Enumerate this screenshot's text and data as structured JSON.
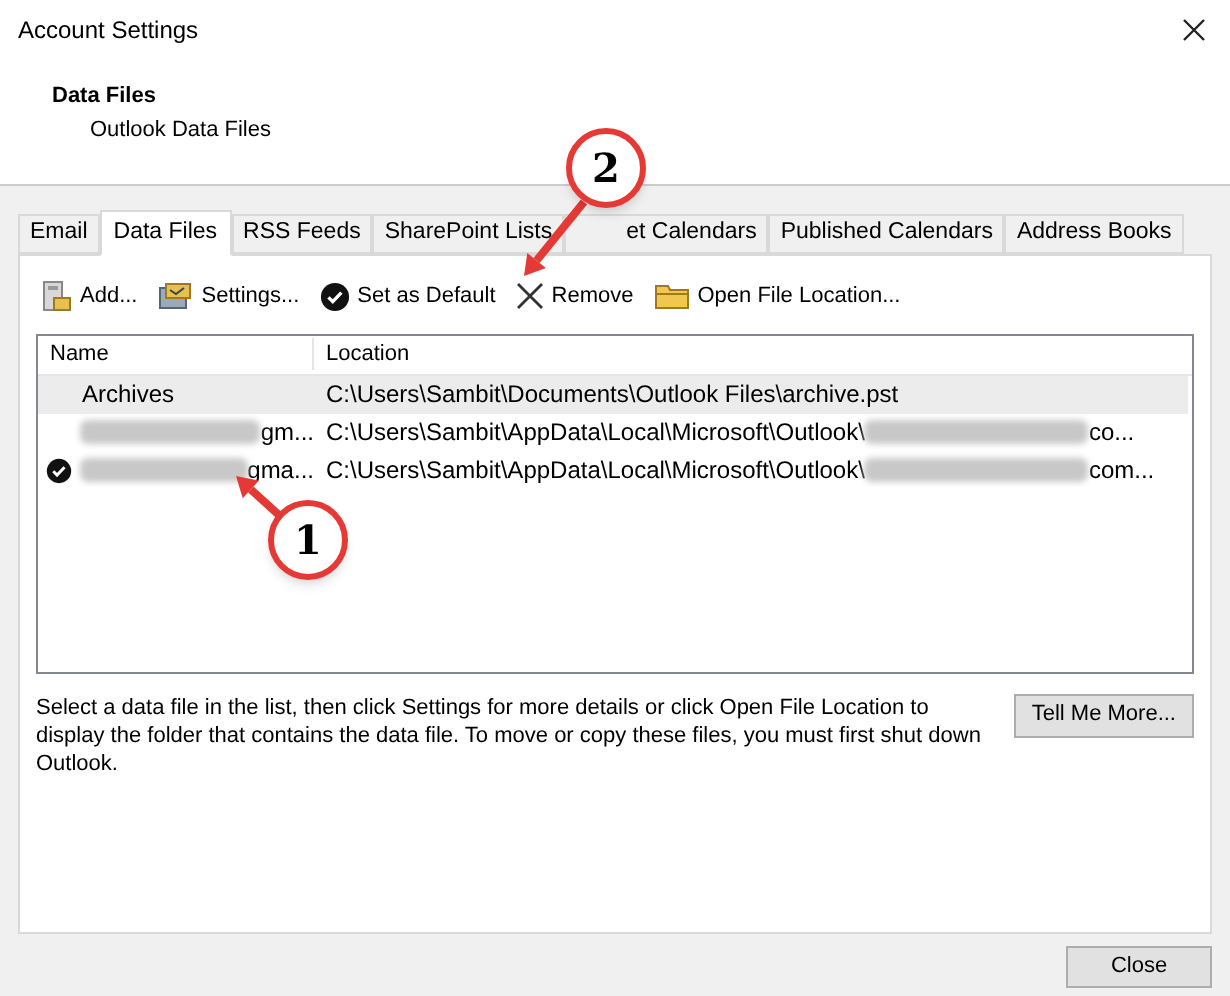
{
  "window": {
    "title": "Account Settings"
  },
  "header": {
    "title": "Data Files",
    "subtitle": "Outlook Data Files"
  },
  "tabs": [
    {
      "label": "Email",
      "selected": false
    },
    {
      "label": "Data Files",
      "selected": true
    },
    {
      "label": "RSS Feeds",
      "selected": false
    },
    {
      "label": "SharePoint Lists",
      "selected": false
    },
    {
      "label": "et Calendars",
      "selected": false
    },
    {
      "label": "Published Calendars",
      "selected": false
    },
    {
      "label": "Address Books",
      "selected": false
    }
  ],
  "toolbar": [
    {
      "kind": "add",
      "label": "Add..."
    },
    {
      "kind": "settings",
      "label": "Settings..."
    },
    {
      "kind": "default",
      "label": "Set as Default"
    },
    {
      "kind": "remove",
      "label": "Remove"
    },
    {
      "kind": "folder",
      "label": "Open File Location..."
    }
  ],
  "table": {
    "columns": [
      "Name",
      "Location"
    ],
    "rows": [
      {
        "name": "Archives",
        "location": "C:\\Users\\Sambit\\Documents\\Outlook Files\\archive.pst",
        "location_end": "",
        "redacted": false,
        "default": false,
        "selected": true
      },
      {
        "name": "gm...",
        "location": "C:\\Users\\Sambit\\AppData\\Local\\Microsoft\\Outlook\\",
        "location_end": "co...",
        "redacted": true,
        "default": false,
        "selected": false
      },
      {
        "name": "gma...",
        "location": "C:\\Users\\Sambit\\AppData\\Local\\Microsoft\\Outlook\\",
        "location_end": "com...",
        "redacted": true,
        "default": true,
        "selected": false
      }
    ]
  },
  "description": "Select a data file in the list, then click Settings for more details or click Open File Location to display the folder that contains the data file. To move or copy these files, you must first shut down Outlook.",
  "help_button": "Tell Me More...",
  "close_button": "Close",
  "callouts": [
    {
      "number": "1"
    },
    {
      "number": "2"
    }
  ]
}
